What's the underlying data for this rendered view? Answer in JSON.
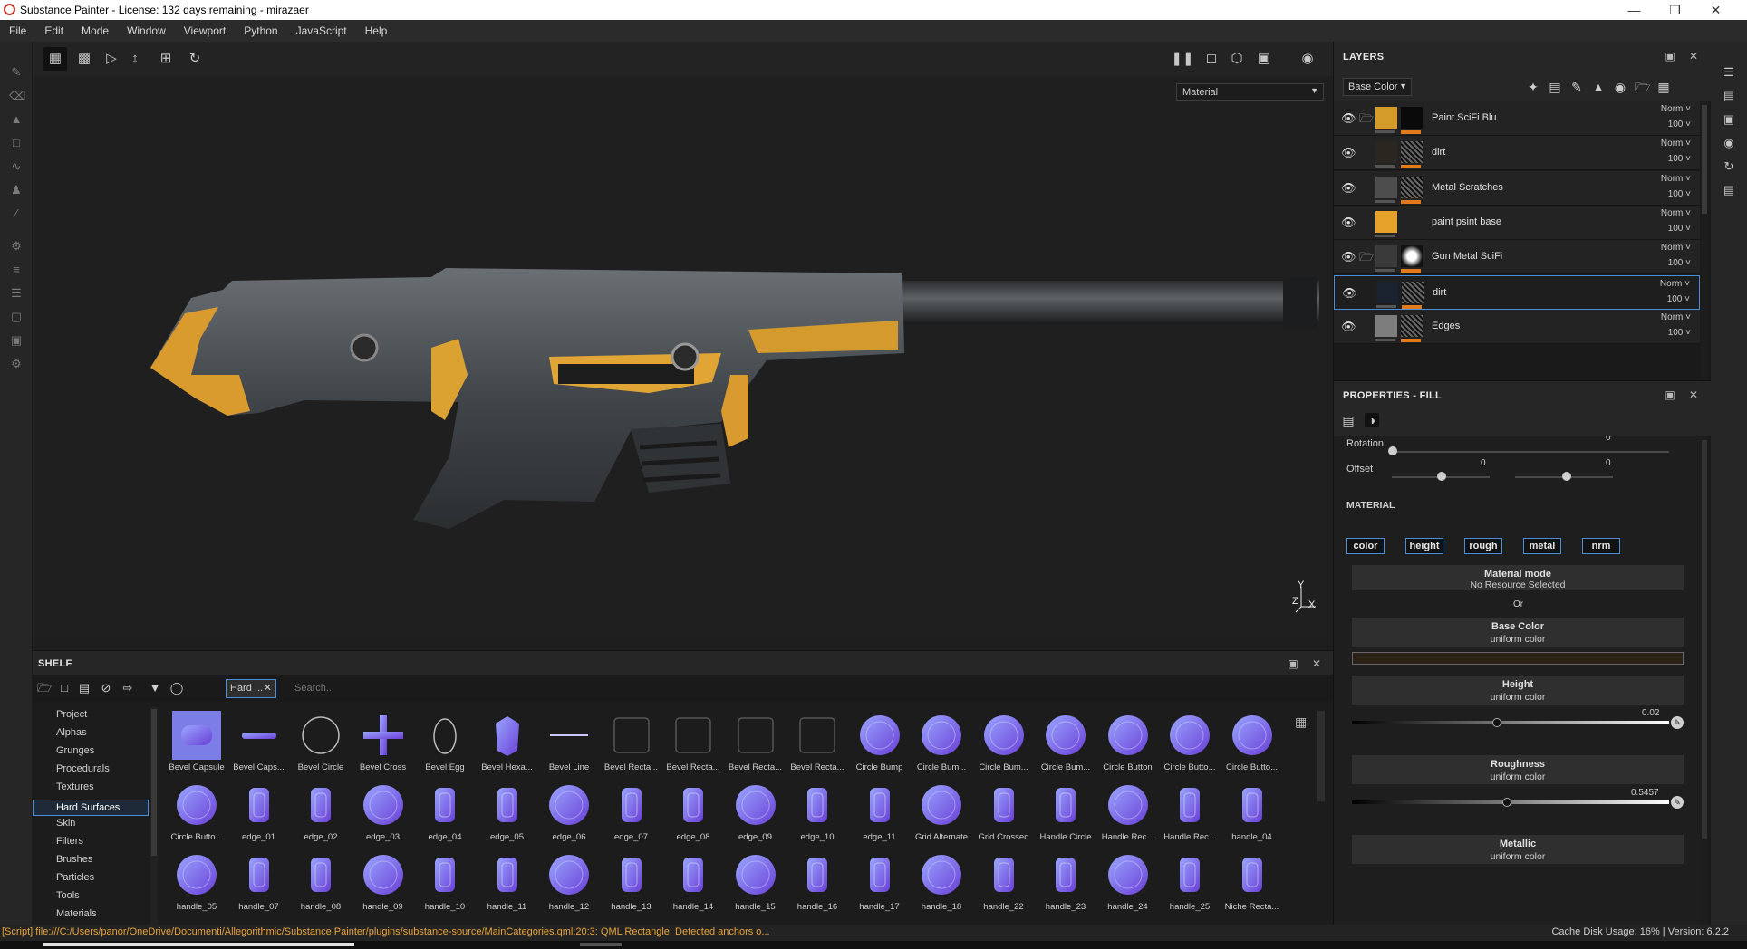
{
  "window": {
    "title": "Substance Painter - License: 132 days remaining - mirazaer"
  },
  "menu": [
    "File",
    "Edit",
    "Mode",
    "Window",
    "Viewport",
    "Python",
    "JavaScript",
    "Help"
  ],
  "viewport": {
    "material_mode": "Material",
    "axis_y": "Y",
    "axis_x": "X",
    "axis_z": "Z"
  },
  "shelf": {
    "title": "SHELF",
    "filter_chip": "Hard ...",
    "search_placeholder": "Search...",
    "categories": [
      "Project",
      "Alphas",
      "Grunges",
      "Procedurals",
      "Textures",
      "Hard Surfaces",
      "Skin",
      "Filters",
      "Brushes",
      "Particles",
      "Tools",
      "Materials"
    ],
    "selected_category": "Hard Surfaces",
    "items": [
      "Bevel Capsule",
      "Bevel Caps...",
      "Bevel Circle",
      "Bevel Cross",
      "Bevel Egg",
      "Bevel Hexa...",
      "Bevel Line",
      "Bevel Recta...",
      "Bevel Recta...",
      "Bevel Recta...",
      "Bevel Recta...",
      "Circle Bump",
      "Circle Bum...",
      "Circle Bum...",
      "Circle Bum...",
      "Circle Button",
      "Circle Butto...",
      "Circle Butto...",
      "Circle Butto...",
      "edge_01",
      "edge_02",
      "edge_03",
      "edge_04",
      "edge_05",
      "edge_06",
      "edge_07",
      "edge_08",
      "edge_09",
      "edge_10",
      "edge_11",
      "Grid Alternate",
      "Grid Crossed",
      "Handle Circle",
      "Handle Rec...",
      "Handle Rec...",
      "handle_04",
      "handle_05",
      "handle_07",
      "handle_08",
      "handle_09",
      "handle_10",
      "handle_11",
      "handle_12",
      "handle_13",
      "handle_14",
      "handle_15",
      "handle_16",
      "handle_17",
      "handle_18",
      "handle_22",
      "handle_23",
      "handle_24",
      "handle_25",
      "Niche Recta..."
    ]
  },
  "status": {
    "message": "[Script] file:///C:/Users/panor/OneDrive/Documenti/Allegorithmic/Substance Painter/plugins/substance-source/MainCategories.qml:20:3: QML Rectangle: Detected anchors o...",
    "cache": "Cache Disk Usage:",
    "cache_value": "16%",
    "version": "Version: 6.2.2"
  },
  "layers": {
    "title": "LAYERS",
    "channel": "Base Color",
    "items": [
      {
        "name": "Paint SciFi Blu",
        "blend": "Norm",
        "opacity": "100",
        "folder": true,
        "color": "#d49a2a",
        "mask": "dark"
      },
      {
        "name": "dirt",
        "blend": "Norm",
        "opacity": "100",
        "folder": false,
        "color": "#2a2620",
        "mask": "noise"
      },
      {
        "name": "Metal Scratches",
        "blend": "Norm",
        "opacity": "100",
        "folder": false,
        "color": "#4d4d4d",
        "mask": "noise"
      },
      {
        "name": "paint psint base",
        "blend": "Norm",
        "opacity": "100",
        "folder": false,
        "color": "#e6a12a",
        "mask": "none"
      },
      {
        "name": "Gun Metal SciFi",
        "blend": "Norm",
        "opacity": "100",
        "folder": true,
        "color": "#3a3a3a",
        "mask": "white"
      },
      {
        "name": "dirt",
        "blend": "Norm",
        "opacity": "100",
        "folder": false,
        "color": "#1a2230",
        "mask": "noise"
      },
      {
        "name": "Edges",
        "blend": "Norm",
        "opacity": "100",
        "folder": false,
        "color": "#7d7d7d",
        "mask": "noise"
      }
    ],
    "selected_index": 5
  },
  "properties": {
    "title": "PROPERTIES - FILL",
    "rotation_label": "Rotation",
    "rotation_value": "0",
    "offset_label": "Offset",
    "offset_x": "0",
    "offset_y": "0",
    "material_section": "MATERIAL",
    "channels": [
      "color",
      "height",
      "rough",
      "metal",
      "nrm"
    ],
    "material_mode": {
      "title": "Material mode",
      "sub": "No Resource Selected"
    },
    "or": "Or",
    "base_color": {
      "title": "Base Color",
      "sub": "uniform color",
      "swatch": "#2b2117"
    },
    "height": {
      "title": "Height",
      "sub": "uniform color",
      "value": "0.02"
    },
    "roughness": {
      "title": "Roughness",
      "sub": "uniform color",
      "value": "0.5457"
    },
    "metallic": {
      "title": "Metallic",
      "sub": "uniform color"
    }
  },
  "colors": {
    "accent": "#4a8edb",
    "orange": "#e07a1b",
    "status_text": "#e8a33a"
  }
}
